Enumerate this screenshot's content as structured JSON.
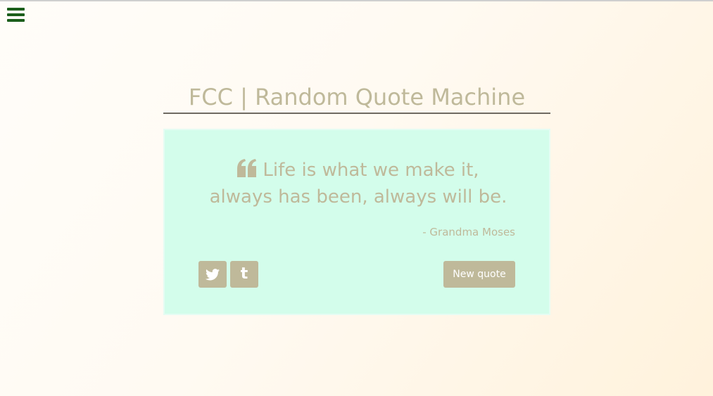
{
  "nav": {
    "menu_icon": "hamburger-menu-icon",
    "menu_color": "#1b5e1b"
  },
  "header": {
    "title": "FCC | Random Quote Machine"
  },
  "quote": {
    "icon": "quote-left-icon",
    "text": "Life is what we make it, always has been, always will be.",
    "author": "- Grandma Moses"
  },
  "actions": {
    "twitter_icon": "twitter-icon",
    "tumblr_icon": "tumblr-icon",
    "tumblr_glyph": "t",
    "new_quote_label": "New quote"
  },
  "colors": {
    "accent": "#bfb99a",
    "card_background": "#d3fdeb",
    "title_underline": "#6f6a62"
  }
}
